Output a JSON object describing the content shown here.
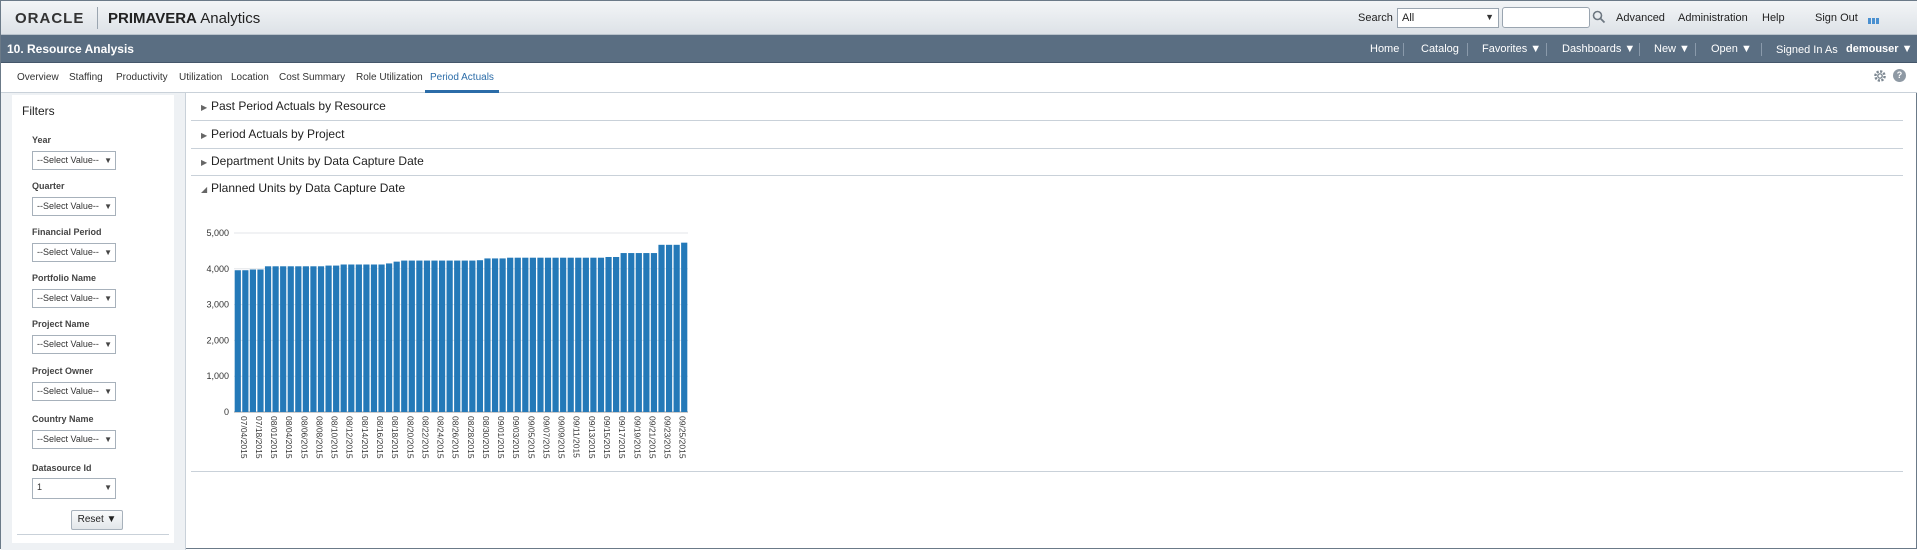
{
  "header": {
    "logo": "ORACLE",
    "app_name_bold": "PRIMAVERA",
    "app_name_rest": " Analytics",
    "search_label": "Search",
    "search_scope": "All",
    "search_value": "",
    "links": {
      "advanced": "Advanced",
      "administration": "Administration",
      "help": "Help",
      "signout": "Sign Out"
    }
  },
  "dashboard_bar": {
    "title": "10. Resource Analysis",
    "nav": {
      "home": "Home",
      "catalog": "Catalog",
      "favorites": "Favorites ▼",
      "dashboards": "Dashboards ▼",
      "new": "New ▼",
      "open": "Open ▼"
    },
    "signed_in_label": "Signed In As",
    "username": "demouser ▼"
  },
  "tabs": [
    "Overview",
    "Staffing",
    "Productivity",
    "Utilization",
    "Location",
    "Cost Summary",
    "Role Utilization",
    "Period Actuals"
  ],
  "active_tab": "Period Actuals",
  "filters": {
    "title": "Filters",
    "items": [
      {
        "label": "Year",
        "value": "--Select Value--"
      },
      {
        "label": "Quarter",
        "value": "--Select Value--"
      },
      {
        "label": "Financial Period",
        "value": "--Select Value--"
      },
      {
        "label": "Portfolio Name",
        "value": "--Select Value--"
      },
      {
        "label": "Project Name",
        "value": "--Select Value--"
      },
      {
        "label": "Project Owner",
        "value": "--Select Value--"
      },
      {
        "label": "Country Name",
        "value": "--Select Value--"
      },
      {
        "label": "Datasource Id",
        "value": "1"
      }
    ],
    "reset_label": "Reset ▼"
  },
  "sections": [
    {
      "title": "Past Period Actuals",
      "by": " by Resource",
      "expanded": false
    },
    {
      "title": "Period Actuals",
      "by": " by Project",
      "expanded": false
    },
    {
      "title": "Department Units",
      "by": " by Data Capture Date",
      "expanded": false
    },
    {
      "title": "Planned Units",
      "by": " by Data Capture Date",
      "expanded": true
    }
  ],
  "chart_data": {
    "type": "bar",
    "ylim": [
      0,
      5000
    ],
    "yticks": [
      "5,000",
      "4,000",
      "3,000",
      "2,000",
      "1,000",
      "0"
    ],
    "ytick_values": [
      5000,
      4000,
      3000,
      2000,
      1000,
      0
    ],
    "color": "#2479b8",
    "values": [
      3960,
      3960,
      3980,
      3980,
      4070,
      4070,
      4070,
      4070,
      4070,
      4070,
      4070,
      4070,
      4090,
      4090,
      4120,
      4120,
      4120,
      4120,
      4120,
      4120,
      4150,
      4200,
      4230,
      4230,
      4230,
      4230,
      4230,
      4230,
      4230,
      4230,
      4230,
      4230,
      4240,
      4290,
      4290,
      4290,
      4310,
      4310,
      4310,
      4310,
      4310,
      4310,
      4310,
      4310,
      4310,
      4310,
      4310,
      4310,
      4310,
      4330,
      4330,
      4440,
      4440,
      4440,
      4440,
      4440,
      4670,
      4670,
      4670,
      4730
    ],
    "x_labels": [
      "07/04/2015",
      "07/18/2015",
      "08/01/2015",
      "08/04/2015",
      "08/06/2015",
      "08/08/2015",
      "08/10/2015",
      "08/12/2015",
      "08/14/2015",
      "08/16/2015",
      "08/18/2015",
      "08/20/2015",
      "08/22/2015",
      "08/24/2015",
      "08/26/2015",
      "08/28/2015",
      "08/30/2015",
      "09/01/2015",
      "09/03/2015",
      "09/05/2015",
      "09/07/2015",
      "09/09/2015",
      "09/11/2015",
      "09/13/2015",
      "09/15/2015",
      "09/17/2015",
      "09/19/2015",
      "09/21/2015",
      "09/23/2015",
      "09/25/2015"
    ]
  }
}
